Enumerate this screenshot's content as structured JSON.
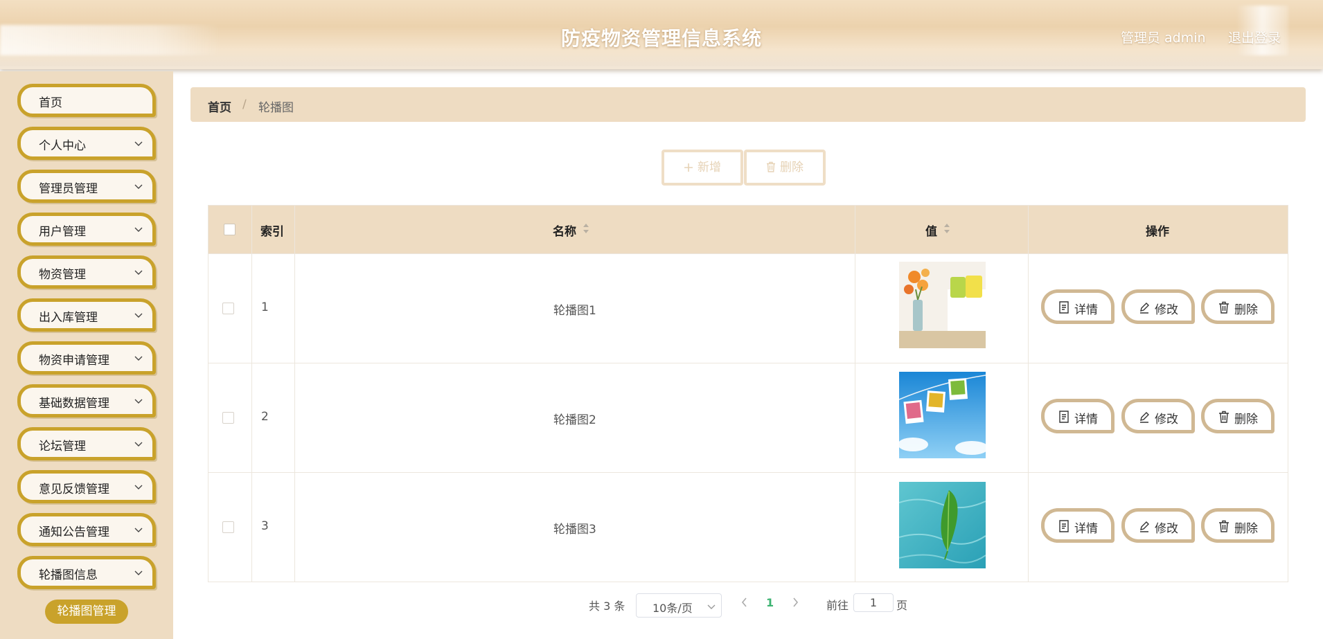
{
  "header": {
    "title": "防疫物资管理信息系统",
    "user": "管理员 admin",
    "logout": "退出登录"
  },
  "sidebar": {
    "items": [
      {
        "label": "首页",
        "has_arrow": false
      },
      {
        "label": "个人中心",
        "has_arrow": true
      },
      {
        "label": "管理员管理",
        "has_arrow": true
      },
      {
        "label": "用户管理",
        "has_arrow": true
      },
      {
        "label": "物资管理",
        "has_arrow": true
      },
      {
        "label": "出入库管理",
        "has_arrow": true
      },
      {
        "label": "物资申请管理",
        "has_arrow": true
      },
      {
        "label": "基础数据管理",
        "has_arrow": true
      },
      {
        "label": "论坛管理",
        "has_arrow": true
      },
      {
        "label": "意见反馈管理",
        "has_arrow": true
      },
      {
        "label": "通知公告管理",
        "has_arrow": true
      },
      {
        "label": "轮播图信息",
        "has_arrow": true
      }
    ],
    "active_submenu": "轮播图管理"
  },
  "breadcrumb": {
    "home": "首页",
    "separator": "/",
    "current": "轮播图"
  },
  "toolbar": {
    "add_label": "新增",
    "delete_label": "删除"
  },
  "table": {
    "columns": {
      "index": "索引",
      "name": "名称",
      "value": "值",
      "actions": "操作"
    },
    "rows": [
      {
        "index": "1",
        "name": "轮播图1",
        "image": "flowers-room"
      },
      {
        "index": "2",
        "name": "轮播图2",
        "image": "photos-sky"
      },
      {
        "index": "3",
        "name": "轮播图3",
        "image": "leaf-water"
      }
    ],
    "actions": {
      "detail": "详情",
      "edit": "修改",
      "delete": "删除"
    }
  },
  "pagination": {
    "total": "共 3 条",
    "page_size": "10条/页",
    "current_page": "1",
    "goto_prefix": "前往",
    "goto_value": "1",
    "goto_suffix": "页"
  },
  "colors": {
    "accent_gold": "#c9a22b",
    "panel_beige": "#eedcc2",
    "action_border": "#d0b893",
    "page_active": "#3cb371"
  }
}
